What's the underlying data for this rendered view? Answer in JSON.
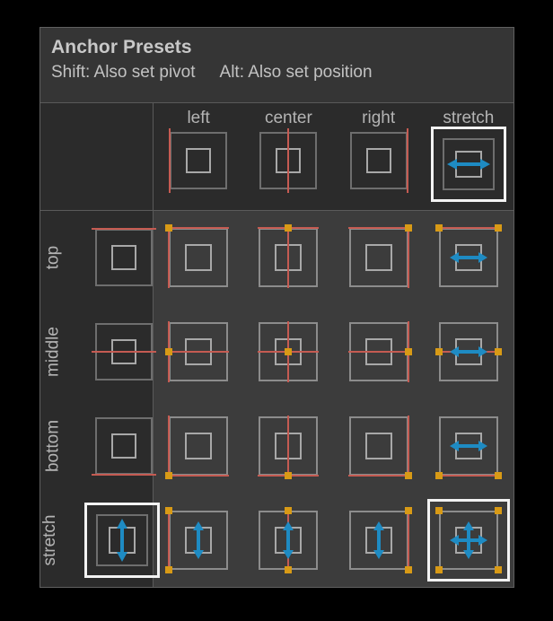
{
  "panel": {
    "title": "Anchor Presets",
    "hint_shift": "Shift: Also set pivot",
    "hint_alt": "Alt: Also set position",
    "colors": {
      "panel_background": "#3c3c3c",
      "header_background": "#353535",
      "label_background": "#2b2b2b",
      "separator": "#5a5a5a",
      "text": "#c8c8c8",
      "anchor_line": "#c55b52",
      "anchor_handle": "#d89a16",
      "stretch_arrow": "#1e8bc3",
      "selection_border": "#f2f2f2",
      "box_outline": "#8c8c8c"
    }
  },
  "columns": [
    {
      "key": "left",
      "label": "left",
      "selected": false
    },
    {
      "key": "center",
      "label": "center",
      "selected": false
    },
    {
      "key": "right",
      "label": "right",
      "selected": false
    },
    {
      "key": "stretch",
      "label": "stretch",
      "selected": true
    }
  ],
  "rows": [
    {
      "key": "top",
      "label": "top",
      "selected": false
    },
    {
      "key": "middle",
      "label": "middle",
      "selected": false
    },
    {
      "key": "bottom",
      "label": "bottom",
      "selected": false
    },
    {
      "key": "stretch",
      "label": "stretch",
      "selected": true
    }
  ],
  "selection": {
    "row": "stretch",
    "column": "stretch"
  },
  "column_header_icons": [
    {
      "column": "left",
      "icon": "anchor-left-icon",
      "vline": "left",
      "arrow": "none"
    },
    {
      "column": "center",
      "icon": "anchor-center-icon",
      "vline": "center",
      "arrow": "none"
    },
    {
      "column": "right",
      "icon": "anchor-right-icon",
      "vline": "right",
      "arrow": "none"
    },
    {
      "column": "stretch",
      "icon": "anchor-stretch-horiz-icon",
      "vline": "none",
      "arrow": "horizontal"
    }
  ],
  "row_header_icons": [
    {
      "row": "top",
      "icon": "anchor-top-icon",
      "hline": "top",
      "arrow": "none"
    },
    {
      "row": "middle",
      "icon": "anchor-middle-icon",
      "hline": "middle",
      "arrow": "none"
    },
    {
      "row": "bottom",
      "icon": "anchor-bottom-icon",
      "hline": "bottom",
      "arrow": "none"
    },
    {
      "row": "stretch",
      "icon": "anchor-stretch-vert-icon",
      "hline": "none",
      "arrow": "vertical"
    }
  ],
  "cells": [
    {
      "row": "top",
      "column": "left",
      "icon": "anchor-preset-top-left-icon",
      "handles": 1,
      "arrow": "none"
    },
    {
      "row": "top",
      "column": "center",
      "icon": "anchor-preset-top-center-icon",
      "handles": 1,
      "arrow": "none"
    },
    {
      "row": "top",
      "column": "right",
      "icon": "anchor-preset-top-right-icon",
      "handles": 1,
      "arrow": "none"
    },
    {
      "row": "top",
      "column": "stretch",
      "icon": "anchor-preset-top-stretch-icon",
      "handles": 2,
      "arrow": "horizontal"
    },
    {
      "row": "middle",
      "column": "left",
      "icon": "anchor-preset-middle-left-icon",
      "handles": 1,
      "arrow": "none"
    },
    {
      "row": "middle",
      "column": "center",
      "icon": "anchor-preset-middle-center-icon",
      "handles": 1,
      "arrow": "none"
    },
    {
      "row": "middle",
      "column": "right",
      "icon": "anchor-preset-middle-right-icon",
      "handles": 1,
      "arrow": "none"
    },
    {
      "row": "middle",
      "column": "stretch",
      "icon": "anchor-preset-middle-stretch-icon",
      "handles": 2,
      "arrow": "horizontal"
    },
    {
      "row": "bottom",
      "column": "left",
      "icon": "anchor-preset-bottom-left-icon",
      "handles": 1,
      "arrow": "none"
    },
    {
      "row": "bottom",
      "column": "center",
      "icon": "anchor-preset-bottom-center-icon",
      "handles": 1,
      "arrow": "none"
    },
    {
      "row": "bottom",
      "column": "right",
      "icon": "anchor-preset-bottom-right-icon",
      "handles": 1,
      "arrow": "none"
    },
    {
      "row": "bottom",
      "column": "stretch",
      "icon": "anchor-preset-bottom-stretch-icon",
      "handles": 2,
      "arrow": "horizontal"
    },
    {
      "row": "stretch",
      "column": "left",
      "icon": "anchor-preset-stretch-left-icon",
      "handles": 2,
      "arrow": "vertical"
    },
    {
      "row": "stretch",
      "column": "center",
      "icon": "anchor-preset-stretch-center-icon",
      "handles": 2,
      "arrow": "vertical"
    },
    {
      "row": "stretch",
      "column": "right",
      "icon": "anchor-preset-stretch-right-icon",
      "handles": 2,
      "arrow": "vertical"
    },
    {
      "row": "stretch",
      "column": "stretch",
      "icon": "anchor-preset-stretch-stretch-icon",
      "handles": 4,
      "arrow": "both"
    }
  ]
}
